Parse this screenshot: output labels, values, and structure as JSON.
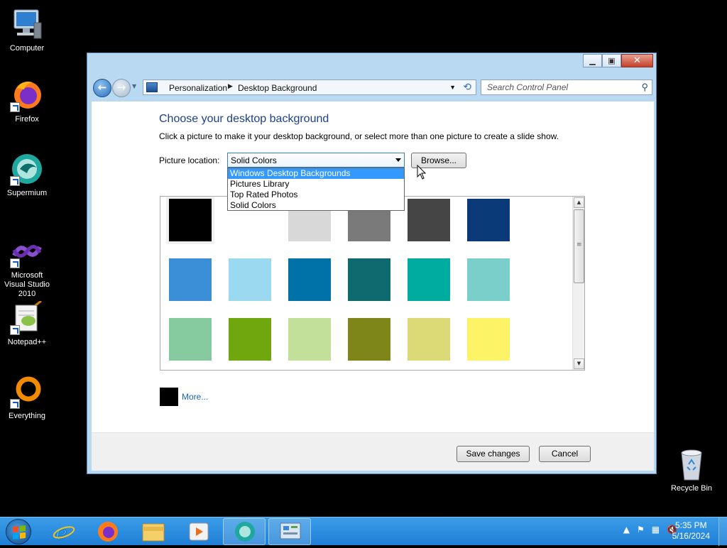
{
  "desktop_icons": [
    {
      "label": "Computer",
      "icon": "computer-icon"
    },
    {
      "label": "Firefox",
      "icon": "firefox-icon"
    },
    {
      "label": "Supermium",
      "icon": "supermium-icon"
    },
    {
      "label": "Microsoft Visual Studio 2010",
      "icon": "visual-studio-icon"
    },
    {
      "label": "Notepad++",
      "icon": "notepadpp-icon"
    },
    {
      "label": "Everything",
      "icon": "everything-icon"
    },
    {
      "label": "Recycle Bin",
      "icon": "recycle-bin-icon"
    }
  ],
  "window": {
    "caption_buttons": {
      "minimize": "▁",
      "maximize": "▣",
      "close": "✕"
    },
    "address": {
      "crumbs": [
        "Personalization",
        "Desktop Background"
      ],
      "separator": "▶"
    },
    "search_placeholder": "Search Control Panel"
  },
  "page": {
    "title": "Choose your desktop background",
    "description": "Click a picture to make it your desktop background, or select more than one picture to create a slide show.",
    "location_label": "Picture location:",
    "location_value": "Solid Colors",
    "browse_label": "Browse...",
    "dropdown_options": [
      {
        "label": "Windows Desktop Backgrounds",
        "selected": true
      },
      {
        "label": "Pictures Library",
        "selected": false
      },
      {
        "label": "Top Rated Photos",
        "selected": false
      },
      {
        "label": "Solid Colors",
        "selected": false
      }
    ],
    "swatches": [
      "#000000",
      "#ffffff",
      "#d8d8d8",
      "#7a7a7a",
      "#454545",
      "#0b3a78",
      "#3a8fd6",
      "#9ad9f0",
      "#0072a8",
      "#0e6a6e",
      "#00aca0",
      "#7bcfca",
      "#86cba0",
      "#70a70f",
      "#c3e09a",
      "#7e8519",
      "#dcda76",
      "#fdf367"
    ],
    "selected_swatch_index": 0,
    "more_label": "More...",
    "more_color": "#000000",
    "save_label": "Save changes",
    "cancel_label": "Cancel"
  },
  "taskbar": {
    "clock_time": "5:35 PM",
    "clock_date": "5/16/2024",
    "apps": [
      "internet-explorer-icon",
      "firefox-icon",
      "file-explorer-icon",
      "media-player-icon",
      "supermium-icon",
      "control-panel-icon"
    ]
  }
}
